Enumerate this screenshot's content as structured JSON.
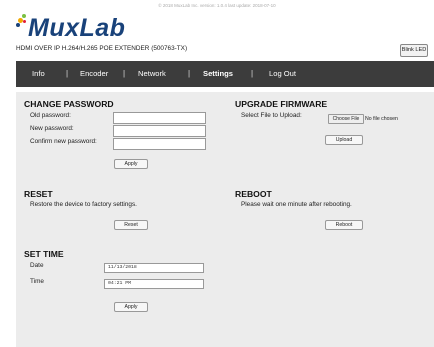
{
  "top_note": "© 2018 MuxLab Inc. version: 1.0.4 last update: 2018-07-10",
  "brand": {
    "logo_text": "MuxLab",
    "product_name": "HDMI OVER IP H.264/H.265 POE EXTENDER (500763-TX)",
    "dot_colors": [
      "#f2a900",
      "#7ac143",
      "#19427a",
      "#e31d38"
    ]
  },
  "blink_led_label": "Blink LED",
  "nav": {
    "items": [
      {
        "label": "Info"
      },
      {
        "label": "Encoder"
      },
      {
        "label": "Network"
      },
      {
        "label": "Settings"
      },
      {
        "label": "Log Out"
      }
    ],
    "separator": "|",
    "active_index": 3
  },
  "change_password": {
    "title": "CHANGE PASSWORD",
    "old_label": "Old password:",
    "new_label": "New password:",
    "confirm_label": "Confirm new password:",
    "old_value": "",
    "new_value": "",
    "confirm_value": "",
    "apply_label": "Apply"
  },
  "upgrade_firmware": {
    "title": "UPGRADE FIRMWARE",
    "select_label": "Select File to Upload:",
    "choose_label": "Choose File",
    "no_file_text": "No file chosen",
    "upload_label": "Upload"
  },
  "reset": {
    "title": "RESET",
    "description": "Restore the device to factory settings.",
    "button_label": "Reset"
  },
  "reboot": {
    "title": "REBOOT",
    "description": "Please wait one minute after rebooting.",
    "button_label": "Reboot"
  },
  "set_time": {
    "title": "SET TIME",
    "date_label": "Date",
    "date_value": "11/13/2018",
    "time_label": "Time",
    "time_value": "04:21 PM",
    "apply_label": "Apply"
  },
  "colors": {
    "nav_bg": "#3c3c3c",
    "panel_bg": "#ececec",
    "logo_blue": "#19427a"
  }
}
